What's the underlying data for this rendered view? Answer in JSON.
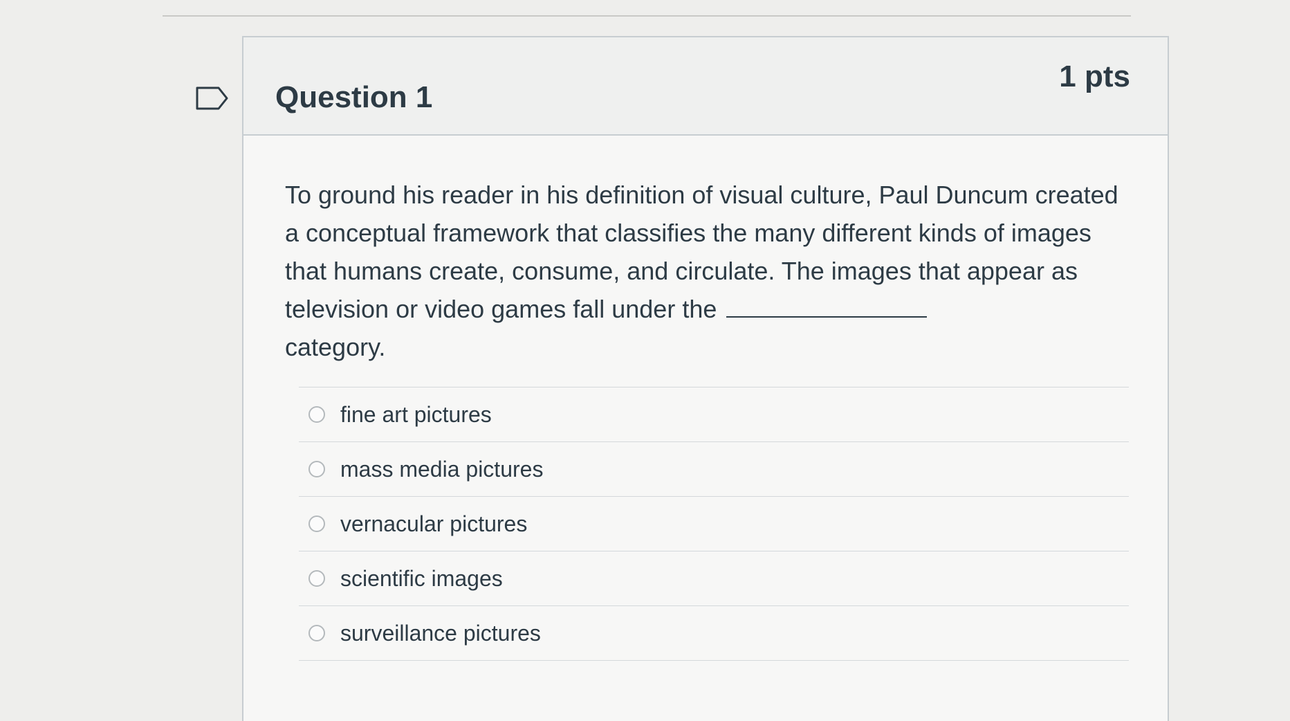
{
  "question": {
    "title": "Question 1",
    "points": "1 pts",
    "text": "To ground his reader in his definition of visual culture, Paul Duncum created a conceptual framework that classifies the many different kinds of images that humans create, consume, and circulate.  The images that appear as television or video games fall under the",
    "text_after_blank": "category.",
    "flag_icon": "flag-outline-icon"
  },
  "answers": [
    {
      "label": "fine art pictures"
    },
    {
      "label": "mass media pictures"
    },
    {
      "label": "vernacular pictures"
    },
    {
      "label": "scientific images"
    },
    {
      "label": "surveillance pictures"
    }
  ],
  "colors": {
    "text": "#2d3b45",
    "border": "#c7cdd1",
    "header_bg": "#eff0ef",
    "body_bg": "#f7f7f6"
  }
}
